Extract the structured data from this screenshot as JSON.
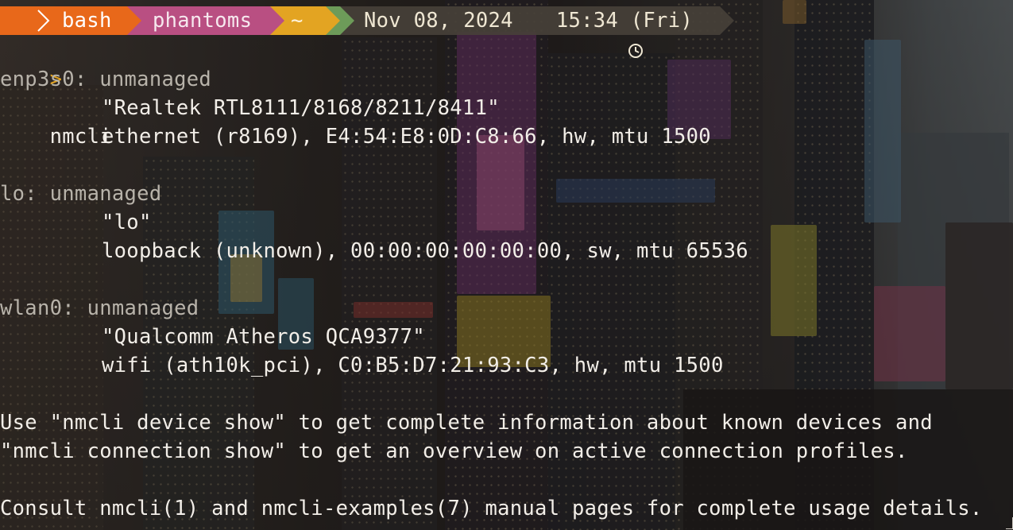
{
  "prompt": {
    "os_icon": "arch-linux-icon",
    "shell": "bash",
    "user": "phantoms",
    "dir": "~",
    "date": "Nov 08, 2024",
    "clock_icon": "clock-icon",
    "time": "15:34 (Fri)",
    "colors": {
      "os": "#e8681a",
      "shell": "#e8681a",
      "user": "#b94f82",
      "dir": "#e3a422",
      "git": "#6d9b59",
      "time": "#464038"
    }
  },
  "command": {
    "caret": ">",
    "text": "nmcli"
  },
  "devices": [
    {
      "header": "enp3s0: unmanaged",
      "model": "\"Realtek RTL8111/8168/8211/8411\"",
      "details": "ethernet (r8169), E4:54:E8:0D:C8:66, hw, mtu 1500"
    },
    {
      "header": "lo: unmanaged",
      "model": "\"lo\"",
      "details": "loopback (unknown), 00:00:00:00:00:00, sw, mtu 65536"
    },
    {
      "header": "wlan0: unmanaged",
      "model": "\"Qualcomm Atheros QCA9377\"",
      "details": "wifi (ath10k_pci), C0:B5:D7:21:93:C3, hw, mtu 1500"
    }
  ],
  "footer": {
    "line1": "Use \"nmcli device show\" to get complete information about known devices and",
    "line2": "\"nmcli connection show\" to get an overview on active connection profiles.",
    "line3": "Consult nmcli(1) and nmcli-examples(7) manual pages for complete usage details."
  }
}
